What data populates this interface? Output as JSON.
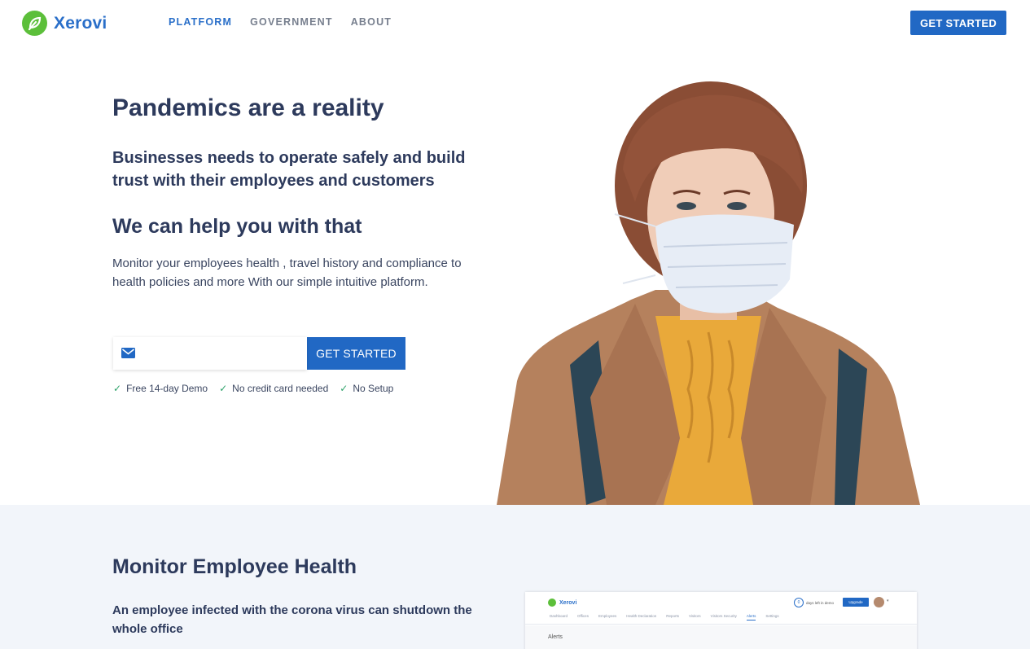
{
  "header": {
    "logo_text": "Xerovi",
    "nav": [
      "PLATFORM",
      "GOVERNMENT",
      "ABOUT"
    ],
    "active_nav": "PLATFORM",
    "cta_label": "GET STARTED"
  },
  "hero": {
    "title": "Pandemics are a reality",
    "subtitle": "Businesses needs to operate safely and build trust with their employees and customers",
    "help_title": "We can help you with that",
    "description": "Monitor your employees health , travel history and compliance to health policies and more With our simple intuitive platform.",
    "email_value": "",
    "email_placeholder": "",
    "button_label": "GET STARTED",
    "perks": [
      "Free 14-day Demo",
      "No credit card needed",
      "No Setup"
    ]
  },
  "section2": {
    "title": "Monitor Employee Health",
    "description": "An employee infected with the corona virus can shutdown the whole office",
    "app_preview": {
      "logo_text": "Xerovi",
      "days_count": "0",
      "days_text": "days left in demo",
      "upgrade_label": "Upgrade",
      "nav": [
        "Dashboard",
        "Offices",
        "Employees",
        "Health Declaration",
        "Reports",
        "Visitors",
        "Visitors Security",
        "Alerts",
        "Settings"
      ],
      "active_nav": "Alerts",
      "section_title": "Alerts"
    }
  },
  "colors": {
    "brand_blue": "#2168c4",
    "brand_green": "#5cbf3a",
    "heading": "#2d3a5c",
    "section_bg": "#f2f5fa",
    "check_green": "#2fa36b"
  },
  "icons": {
    "logo": "leaf-logo-icon",
    "email": "envelope-icon",
    "perk": "check-icon"
  }
}
